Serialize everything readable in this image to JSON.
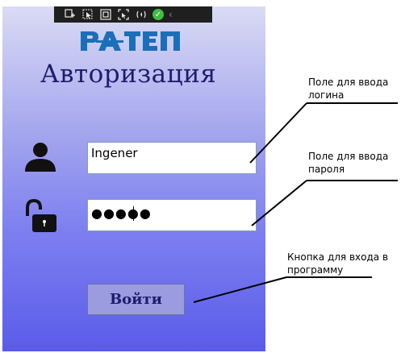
{
  "toolbar": {
    "icons": [
      "live-visual-tree-icon",
      "select-element-icon",
      "display-adorners-icon",
      "track-focus-icon",
      "hot-reload-icon",
      "success-check-icon",
      "collapse-arrow-icon"
    ]
  },
  "logo": {
    "text": "РАТЕП",
    "color": "#1b6fb8"
  },
  "login_form": {
    "title": "Авторизация",
    "login_value": "Ingener",
    "password_value": "●●●●●",
    "submit_label": "Войти"
  },
  "annotations": {
    "login_note": "Поле для ввода логина",
    "password_note": "Поле для ввода пароля",
    "button_note": "Кнопка для входа в программу"
  },
  "colors": {
    "title": "#1d1d6e",
    "panel_top": "#dadbf4",
    "panel_bottom": "#5a5cea",
    "button_bg": "#9b9ce0"
  }
}
